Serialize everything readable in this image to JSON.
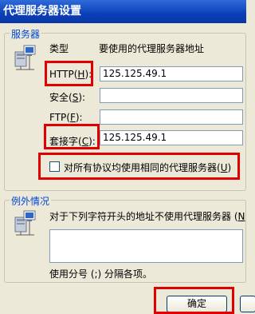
{
  "window": {
    "title": "代理服务器设置"
  },
  "servers": {
    "group_title": "服务器",
    "type_header": "类型",
    "address_header": "要使用的代理服务器地址",
    "http_label": "HTTP",
    "http_key": "H",
    "http_value": "125.125.49.1",
    "secure_label": "安全",
    "secure_key": "S",
    "secure_value": "",
    "ftp_label": "FTP",
    "ftp_key": "F",
    "ftp_value": "",
    "socks_label": "套接字",
    "socks_key": "C",
    "socks_value": "125.125.49.1",
    "same_proxy_label": "对所有协议均使用相同的代理服务器",
    "same_proxy_key": "U",
    "same_proxy_checked": false
  },
  "exceptions": {
    "group_title": "例外情况",
    "description": "对于下列字符开头的地址不使用代理服务器",
    "description_key": "N",
    "value": "",
    "hint": "使用分号 (;) 分隔各项。"
  },
  "buttons": {
    "ok_label": "确定"
  },
  "colors": {
    "highlight": "#e00000",
    "titlebar": "#0a3fb8",
    "group_title": "#0046d5"
  }
}
